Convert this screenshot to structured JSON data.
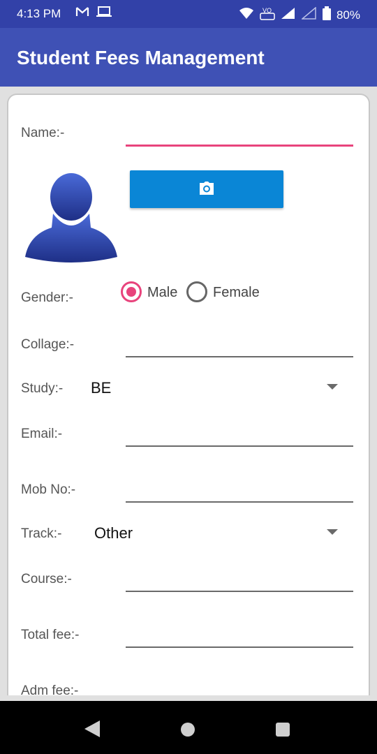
{
  "status_bar": {
    "time": "4:13 PM",
    "battery": "80%"
  },
  "app_bar": {
    "title": "Student Fees Management"
  },
  "form": {
    "name_label": "Name:-",
    "gender_label": "Gender:-",
    "gender_options": [
      "Male",
      "Female"
    ],
    "gender_selected": "Male",
    "college_label": "Collage:-",
    "study_label": "Study:-",
    "study_value": "BE",
    "email_label": "Email:-",
    "mobile_label": "Mob No:-",
    "track_label": "Track:-",
    "track_value": "Other",
    "course_label": "Course:-",
    "total_fee_label": "Total fee:-",
    "adm_fee_label": "Adm fee:-"
  },
  "colors": {
    "app_bar": "#3f51b5",
    "status_bar": "#3241a8",
    "accent": "#e8437c",
    "button": "#0a86d6"
  },
  "icons": [
    "mail-icon",
    "laptop-icon",
    "wifi-icon",
    "signal-icon",
    "battery-icon",
    "camera-icon",
    "avatar-icon"
  ]
}
